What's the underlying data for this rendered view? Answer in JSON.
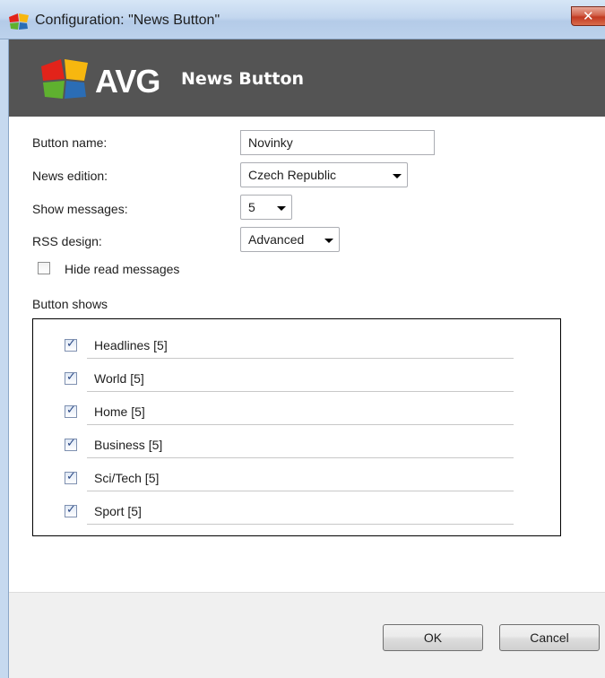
{
  "window": {
    "title": "Configuration: \"News Button\""
  },
  "header": {
    "brand": "AVG",
    "title": "News Button"
  },
  "form": {
    "button_name_label": "Button name:",
    "button_name_value": "Novinky",
    "news_edition_label": "News edition:",
    "news_edition_value": "Czech Republic",
    "show_messages_label": "Show messages:",
    "show_messages_value": "5",
    "rss_design_label": "RSS design:",
    "rss_design_value": "Advanced",
    "hide_read_label": "Hide read messages",
    "hide_read_checked": false
  },
  "button_shows": {
    "label": "Button shows",
    "items": [
      {
        "label": "Headlines [5]",
        "checked": true
      },
      {
        "label": "World [5]",
        "checked": true
      },
      {
        "label": "Home [5]",
        "checked": true
      },
      {
        "label": "Business [5]",
        "checked": true
      },
      {
        "label": "Sci/Tech [5]",
        "checked": true
      },
      {
        "label": "Sport [5]",
        "checked": true
      }
    ]
  },
  "footer": {
    "ok_label": "OK",
    "cancel_label": "Cancel"
  },
  "colors": {
    "header_bg": "#545454",
    "logo_red": "#e2231a",
    "logo_yellow": "#f7b70f",
    "logo_green": "#5fb12f",
    "logo_blue": "#2b6db5"
  }
}
